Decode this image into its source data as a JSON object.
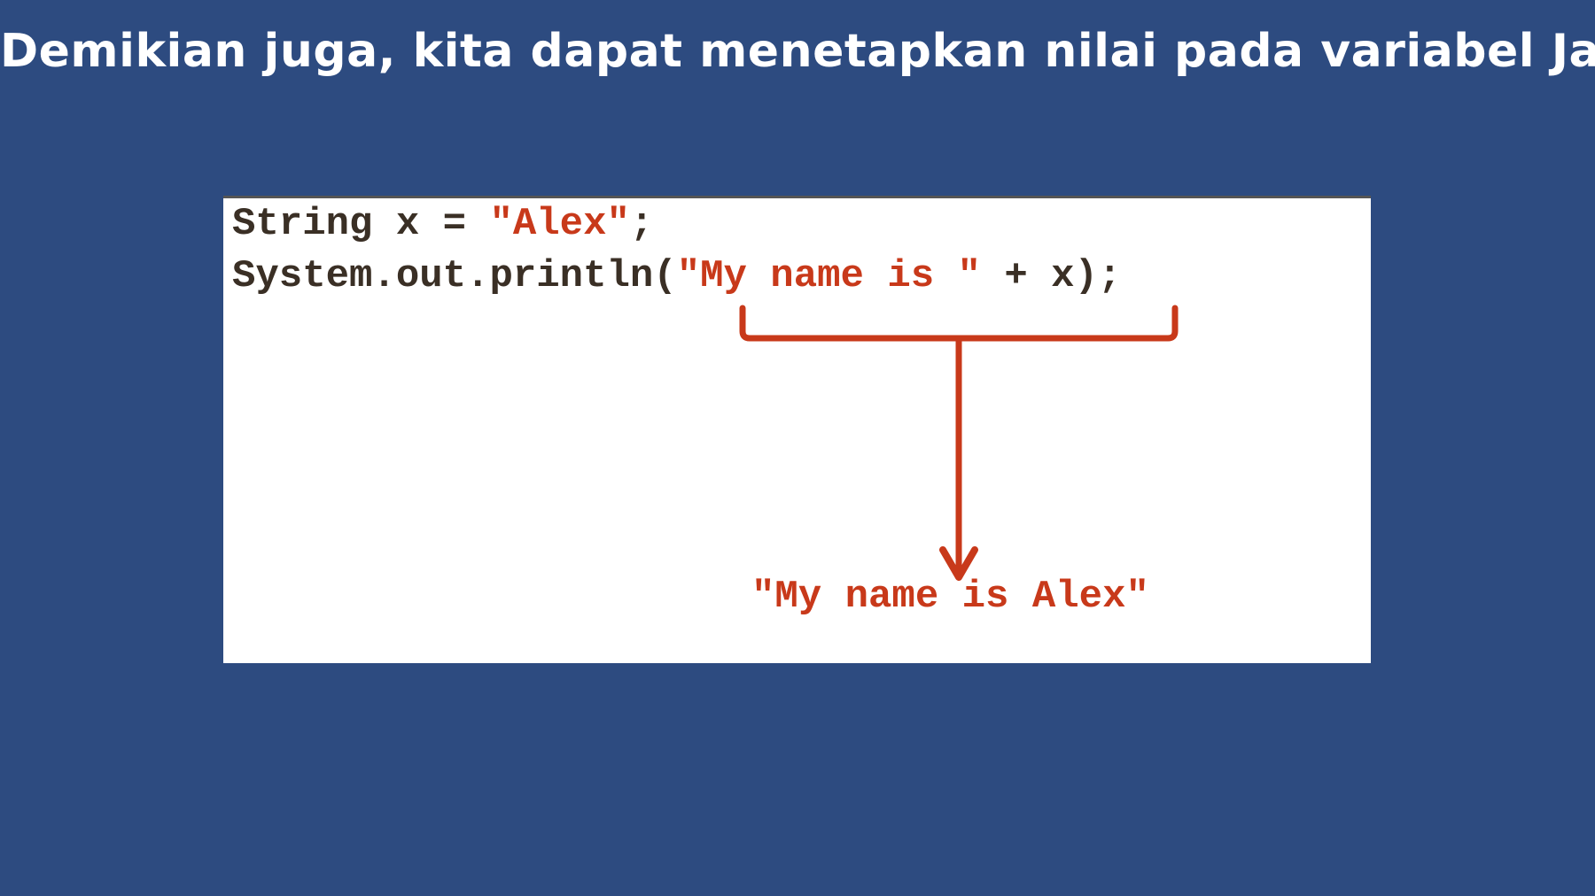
{
  "title": "Demikian juga, kita dapat menetapkan nilai pada variabel Java",
  "code": {
    "line1": {
      "prefix": "String x = ",
      "string": "\"Alex\"",
      "suffix": ";"
    },
    "line2": {
      "prefix": "System.out.println(",
      "string": "\"My name is \"",
      "suffix": " + x);"
    }
  },
  "result": "\"My name is Alex\"",
  "colors": {
    "background": "#2d4b80",
    "code_text": "#3a2f25",
    "string_literal": "#c8391a",
    "arrow": "#c8391a"
  },
  "icons": {
    "bracket": "bracket-icon",
    "arrow": "arrow-down-icon"
  }
}
